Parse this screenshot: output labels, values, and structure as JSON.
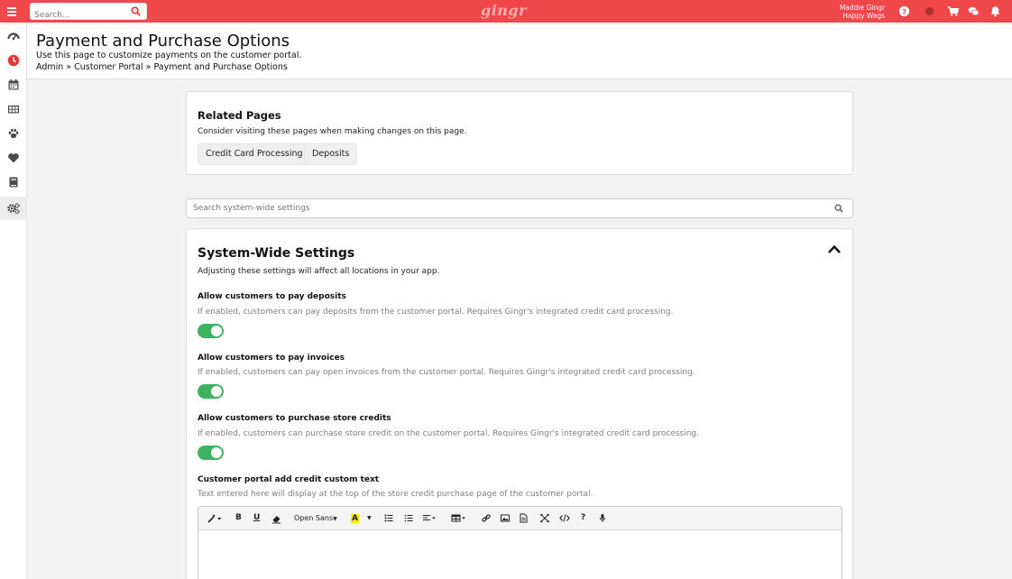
{
  "topbar": {
    "search_placeholder": "Search...",
    "logo": "gingr",
    "user_name": "Maddie Gingr",
    "location": "Happy Wags"
  },
  "header": {
    "title": "Payment and Purchase Options",
    "description": "Use this page to customize payments on the customer portal.",
    "breadcrumb": [
      "Admin",
      "Customer Portal",
      "Payment and Purchase Options"
    ],
    "separator": "»"
  },
  "related": {
    "title": "Related Pages",
    "subtitle": "Consider visiting these pages when making changes on this page.",
    "buttons": [
      "Credit Card Processing",
      "Deposits"
    ]
  },
  "settings_search": {
    "placeholder": "Search system-wide settings"
  },
  "system": {
    "title": "System-Wide Settings",
    "subtitle": "Adjusting these settings will affect all locations in your app.",
    "settings": [
      {
        "title": "Allow customers to pay deposits",
        "desc": "If enabled, customers can pay deposits from the customer portal. Requires Gingr's integrated credit card processing.",
        "enabled": true
      },
      {
        "title": "Allow customers to pay invoices",
        "desc": "If enabled, customers can pay open invoices from the customer portal. Requires Gingr's integrated credit card processing.",
        "enabled": true
      },
      {
        "title": "Allow customers to purchase store credits",
        "desc": "If enabled, customers can purchase store credit on the customer portal. Requires Gingr's integrated credit card processing.",
        "enabled": true
      },
      {
        "title": "Customer portal add credit custom text",
        "desc": "Text entered here will display at the top of the store credit purchase page of the customer portal."
      }
    ]
  },
  "editor": {
    "font_name": "Open Sans",
    "bold": "B",
    "underline": "U",
    "highlight": "A",
    "help": "?"
  },
  "colors": {
    "brand": "#f0474b",
    "toggle_on": "#3eb35f",
    "sidebar_active_icon": "#f0474b"
  }
}
